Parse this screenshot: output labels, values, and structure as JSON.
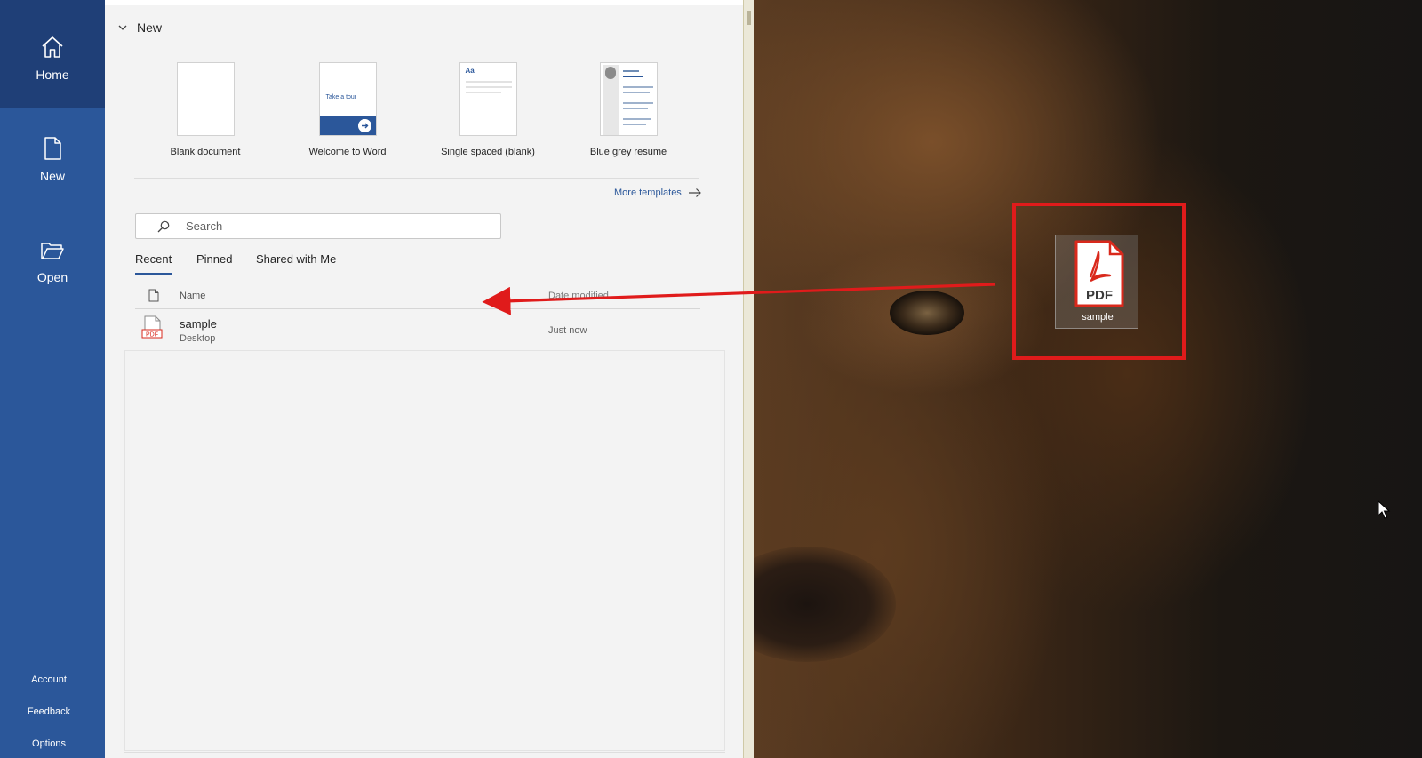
{
  "nav": {
    "home_label": "Home",
    "new_label": "New",
    "open_label": "Open",
    "account_label": "Account",
    "feedback_label": "Feedback",
    "options_label": "Options",
    "icons": {
      "home": "home-icon",
      "new": "new-document-icon",
      "open": "folder-open-icon"
    }
  },
  "new_section": {
    "title": "New",
    "templates": [
      {
        "label": "Blank document",
        "thumb_text": ""
      },
      {
        "label": "Welcome to Word",
        "thumb_text": "Take a tour"
      },
      {
        "label": "Single spaced (blank)",
        "thumb_text": "Aa"
      },
      {
        "label": "Blue grey resume",
        "thumb_text": ""
      }
    ],
    "more_templates_label": "More templates"
  },
  "search": {
    "placeholder": "Search"
  },
  "tabs": {
    "recent": "Recent",
    "pinned": "Pinned",
    "shared": "Shared with Me",
    "active": "Recent"
  },
  "file_list": {
    "columns": {
      "name": "Name",
      "date": "Date modified"
    },
    "rows": [
      {
        "name": "sample",
        "location": "Desktop",
        "date": "Just now",
        "type_badge": "PDF"
      }
    ]
  },
  "desktop": {
    "pdf_icon_badge": "PDF",
    "pdf_icon_label": "sample"
  },
  "colors": {
    "word_blue": "#2b579a",
    "word_blue_active": "#1f3f77",
    "panel_bg": "#f3f3f3",
    "annotation_red": "#e01b1b",
    "pdf_red": "#d9291c"
  }
}
